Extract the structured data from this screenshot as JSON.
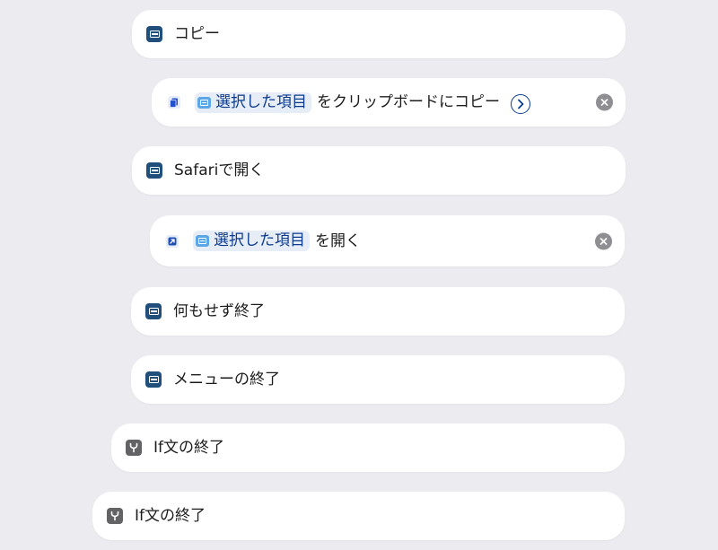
{
  "actions": {
    "copy": {
      "label": "コピー"
    },
    "copy_to_clipboard": {
      "token": "選択した項目",
      "suffix": "をクリップボードにコピー"
    },
    "open_in_safari": {
      "label": "Safariで開く"
    },
    "open_item": {
      "token": "選択した項目",
      "suffix": "を開く"
    },
    "exit_without_action": {
      "label": "何もせず終了"
    },
    "end_menu": {
      "label": "メニューの終了"
    },
    "end_if_1": {
      "label": "If文の終了"
    },
    "end_if_2": {
      "label": "If文の終了"
    }
  },
  "icons": {
    "menu_item": "menu-item-icon",
    "clipboard": "clipboard-icon",
    "open": "open-arrow-icon",
    "if_branch": "if-branch-icon",
    "clear": "clear-icon",
    "chevron": "chevron-right-circle-icon"
  },
  "colors": {
    "background": "#ebebf0",
    "card": "#ffffff",
    "menu_icon": "#1f4f7a",
    "if_icon": "#636366",
    "token_text": "#0b3b8f",
    "clear_button": "#8e8e93"
  }
}
